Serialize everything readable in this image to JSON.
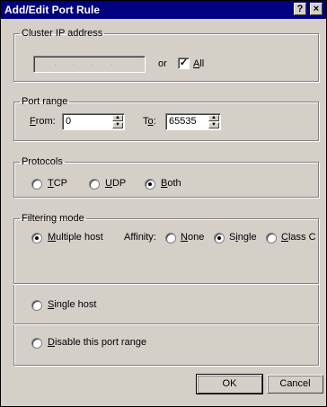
{
  "window": {
    "title": "Add/Edit Port Rule",
    "help_label": "?",
    "close_label": "×"
  },
  "cluster_ip": {
    "legend": "Cluster IP address",
    "address_dots": "....",
    "or_label": "or",
    "all_checked": true,
    "all_label_mnemonic": "A",
    "all_label_rest": "ll",
    "check_mark": "✓"
  },
  "port_range": {
    "legend": "Port range",
    "from_mnemonic": "F",
    "from_rest": "rom:",
    "from_value": "0",
    "to_prefix": "T",
    "to_mnemonic": "o",
    "to_rest": ":",
    "to_value": "65535"
  },
  "protocols": {
    "legend": "Protocols",
    "options": [
      {
        "mnemonic": "T",
        "rest": "CP",
        "selected": false
      },
      {
        "mnemonic": "U",
        "rest": "DP",
        "selected": false
      },
      {
        "mnemonic": "B",
        "rest": "oth",
        "selected": true
      }
    ]
  },
  "filtering": {
    "legend": "Filtering mode",
    "multiple_host": {
      "mnemonic": "M",
      "rest": "ultiple host",
      "selected": true
    },
    "affinity_label": "Affinity:",
    "affinity_options": [
      {
        "mnemonic": "N",
        "rest": "one",
        "selected": false
      },
      {
        "prefix": "S",
        "mnemonic": "i",
        "rest": "ngle",
        "selected": true
      },
      {
        "mnemonic": "C",
        "rest": "lass C",
        "selected": false
      }
    ],
    "single_host": {
      "mnemonic": "S",
      "rest": "ingle host",
      "selected": false
    },
    "disable": {
      "mnemonic": "D",
      "rest": "isable this port range",
      "selected": false
    }
  },
  "buttons": {
    "ok": "OK",
    "cancel": "Cancel"
  }
}
